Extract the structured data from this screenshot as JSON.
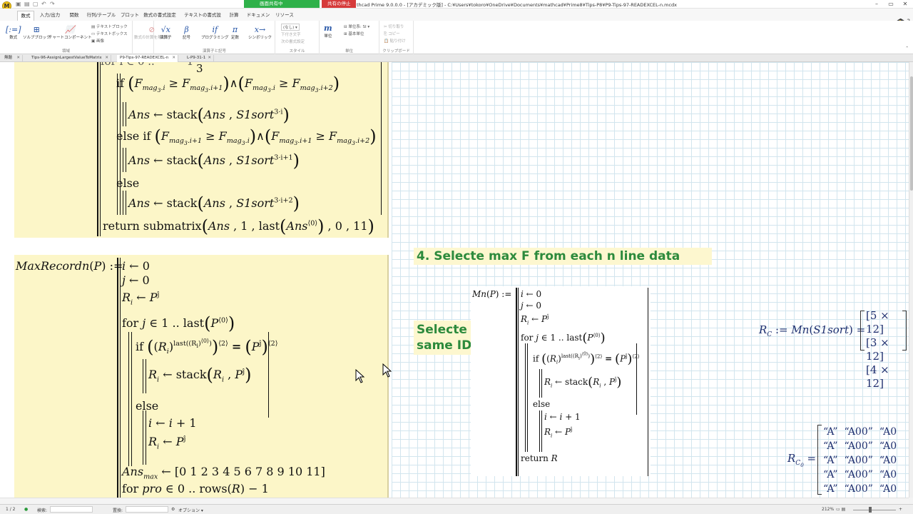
{
  "titlebar": {
    "share_label": "画面共有中",
    "stop_label": "共有の停止",
    "window_title": "thcad Prime 9.0.0.0 - [アカデミック版] - C:¥Users¥tokoro¥OneDrive¥Documents¥mathcad¥Prime8¥Tips-P8¥P9-Tips-97-READEXCEL-n.mcdx",
    "logo": "M"
  },
  "ribbon_tabs": [
    "数式",
    "入力/出力",
    "関数",
    "行列/テーブル",
    "プロット",
    "数式の書式設定",
    "テキストの書式設定",
    "計算",
    "ドキュメント",
    "リソース"
  ],
  "ribbon": {
    "math_btn": "数式",
    "solve_block": "ソルブブロック",
    "chart_component": "チャートコンポーネント",
    "text_block": "テキストブロック",
    "text_box": "テキストボックス",
    "image": "画像",
    "regions_label": "領域",
    "disable_calc": "数式の計算を無効化",
    "operators": "演算子",
    "symbols": "記号",
    "programming": "プログラミング",
    "constants": "定数",
    "symbolics": "シンボリック",
    "ops_label": "演算子と記号",
    "style_select": "(なし)",
    "apply_style": "下付き文字",
    "format_painter": "次の書式設定",
    "style_label": "スタイル",
    "units_btn": "単位",
    "unit_system": "単位系: SI",
    "base_units": "基本単位",
    "units_label": "単位",
    "cut": "切り取り",
    "copy": "コピー",
    "paste": "貼り付け",
    "clipboard_label": "クリップボード"
  },
  "doc_tabs": [
    "無題",
    "Tips-96-AssignLargestValueToMatrix",
    "P9-Tips-97-READEXCEL-n",
    "L-P9-31-1"
  ],
  "doc_tab_close": "✕",
  "worksheet": {
    "heading": "4. Selecte max F from each n line data",
    "note": [
      "Selecte",
      "same ID"
    ],
    "maxrecord_def": "MaxRecordn",
    "mn_def": "Mn",
    "rc_result": [
      "[5 × 12]",
      "[3 × 12]",
      "[4 × 12]"
    ],
    "rc0_rows": [
      [
        "“A”",
        "“A00”",
        "“A0"
      ],
      [
        "“A”",
        "“A00”",
        "“A0"
      ],
      [
        "“A”",
        "“A00”",
        "“A0"
      ],
      [
        "“A”",
        "“A00”",
        "“A0"
      ],
      [
        "“A”",
        "“A00”",
        "“A0"
      ]
    ],
    "ans_max_row": "[0  1  2  3  4  5  6  7  8  9  10  11]"
  },
  "statusbar": {
    "page": "1 / 2",
    "search_label": "検索:",
    "replace_label": "置換:",
    "options_label": "オプション",
    "zoom": "212%"
  },
  "colors": {
    "region_bg": "#fcf6c8",
    "heading_green": "#2c8a3c",
    "grid_line": "#d2e5ee",
    "share_green": "#2fb14a",
    "stop_red": "#d63a3a",
    "result_blue": "#1e2f6f"
  }
}
